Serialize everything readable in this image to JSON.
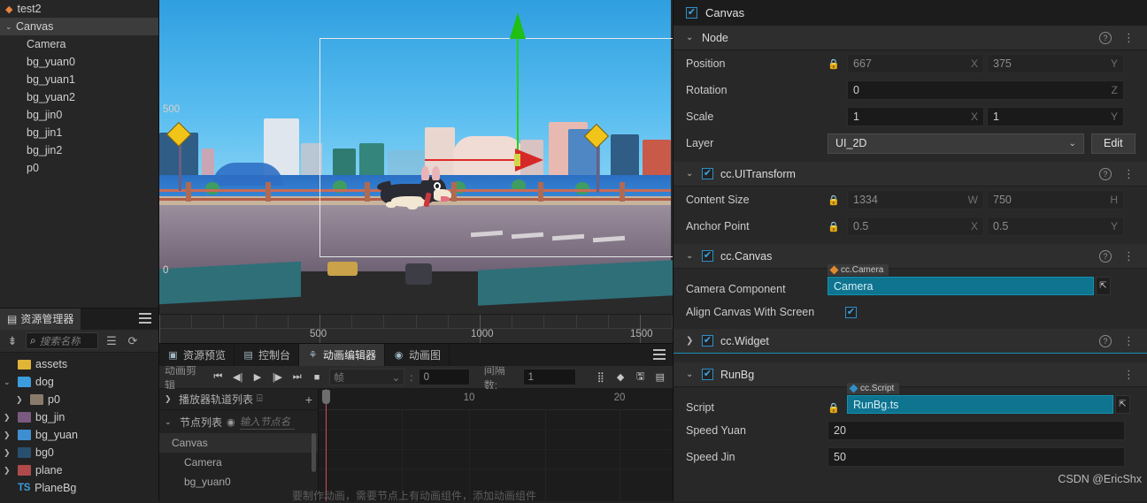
{
  "hierarchy": {
    "project": "test2",
    "nodes": [
      {
        "label": "Canvas",
        "level": 0,
        "expandable": true,
        "selected": true
      },
      {
        "label": "Camera",
        "level": 1,
        "expandable": false,
        "selected": false
      },
      {
        "label": "bg_yuan0",
        "level": 1,
        "expandable": false,
        "selected": false
      },
      {
        "label": "bg_yuan1",
        "level": 1,
        "expandable": false,
        "selected": false
      },
      {
        "label": "bg_yuan2",
        "level": 1,
        "expandable": false,
        "selected": false
      },
      {
        "label": "bg_jin0",
        "level": 1,
        "expandable": false,
        "selected": false
      },
      {
        "label": "bg_jin1",
        "level": 1,
        "expandable": false,
        "selected": false
      },
      {
        "label": "bg_jin2",
        "level": 1,
        "expandable": false,
        "selected": false
      },
      {
        "label": "p0",
        "level": 1,
        "expandable": false,
        "selected": false
      }
    ]
  },
  "assets": {
    "tab_label": "资源管理器",
    "search_placeholder": "搜索名称",
    "items": [
      {
        "label": "assets",
        "level": 0,
        "expandable": false,
        "icon": "database-icon",
        "color": "#e0b437"
      },
      {
        "label": "dog",
        "level": 0,
        "expandable": true,
        "expanded": true,
        "icon": "folder-icon",
        "color": "#3b9ddd"
      },
      {
        "label": "p0",
        "level": 1,
        "expandable": true,
        "expanded": false,
        "icon": "sprite-icon",
        "color": "#8a7a6a"
      },
      {
        "label": "bg_jin",
        "level": 0,
        "expandable": true,
        "expanded": false,
        "icon": "image-icon",
        "color": "#7a5a7e"
      },
      {
        "label": "bg_yuan",
        "level": 0,
        "expandable": true,
        "expanded": false,
        "icon": "image-icon",
        "color": "#3f8fd0"
      },
      {
        "label": "bg0",
        "level": 0,
        "expandable": true,
        "expanded": false,
        "icon": "image-icon",
        "color": "#28506e"
      },
      {
        "label": "plane",
        "level": 0,
        "expandable": true,
        "expanded": false,
        "icon": "image-icon",
        "color": "#b04a4a"
      },
      {
        "label": "PlaneBg",
        "level": 0,
        "expandable": false,
        "icon": "typescript-icon",
        "color": "#3b9ddd"
      }
    ]
  },
  "scene": {
    "ruler_x_labels": [
      "500",
      "1000",
      "1500"
    ],
    "ruler_y_labels": [
      "500",
      "0"
    ]
  },
  "animation": {
    "tabs": [
      {
        "label": "资源预览",
        "icon": "preview-icon",
        "active": false
      },
      {
        "label": "控制台",
        "icon": "console-icon",
        "active": false
      },
      {
        "label": "动画编辑器",
        "icon": "animation-icon",
        "active": true
      },
      {
        "label": "动画图",
        "icon": "graph-icon",
        "active": false
      }
    ],
    "toolbar": {
      "clip_label": "动画剪辑",
      "frame_mode": "帧",
      "colon": ":",
      "frame_value": "0",
      "interval_label": "间隔数:",
      "interval_value": "1"
    },
    "track_header": "播放器轨道列表",
    "node_header": "节点列表",
    "node_input_placeholder": "输入节点名",
    "node_rows": [
      {
        "label": "Canvas",
        "level": 1,
        "selected": true
      },
      {
        "label": "Camera",
        "level": 2,
        "selected": false
      },
      {
        "label": "bg_yuan0",
        "level": 2,
        "selected": false
      }
    ],
    "ruler_labels": [
      "10",
      "20"
    ],
    "bottom_hint": "要制作动画，需要节点上有动画组件，添加动画组件"
  },
  "inspector": {
    "node_name": "Canvas",
    "node_enabled": true,
    "sections": {
      "node": {
        "title": "Node",
        "rows": [
          {
            "label": "Position",
            "locked": true,
            "x": "667",
            "y": "375",
            "xa": "X",
            "ya": "Y"
          },
          {
            "label": "Rotation",
            "locked": false,
            "x": "0",
            "xa": "Z"
          },
          {
            "label": "Scale",
            "locked": false,
            "x": "1",
            "y": "1",
            "xa": "X",
            "ya": "Y"
          }
        ],
        "layer_label": "Layer",
        "layer_value": "UI_2D",
        "edit_label": "Edit"
      },
      "ui_transform": {
        "title": "cc.UITransform",
        "enabled": true,
        "rows": [
          {
            "label": "Content Size",
            "locked": true,
            "x": "1334",
            "y": "750",
            "xa": "W",
            "ya": "H"
          },
          {
            "label": "Anchor Point",
            "locked": true,
            "x": "0.5",
            "y": "0.5",
            "xa": "X",
            "ya": "Y"
          }
        ]
      },
      "canvas": {
        "title": "cc.Canvas",
        "enabled": true,
        "camera_label": "Camera Component",
        "camera_badge": "cc.Camera",
        "camera_value": "Camera",
        "align_label": "Align Canvas With Screen",
        "align_checked": true
      },
      "widget": {
        "title": "cc.Widget",
        "enabled": true,
        "collapsed": true
      },
      "runbg": {
        "title": "RunBg",
        "enabled": true,
        "script_label": "Script",
        "script_badge": "cc.Script",
        "script_value": "RunBg.ts",
        "props": [
          {
            "label": "Speed Yuan",
            "value": "20"
          },
          {
            "label": "Speed Jin",
            "value": "50"
          }
        ]
      }
    },
    "watermark": "CSDN @EricShx"
  },
  "colors": {
    "accent": "#0e7490",
    "checkbox": "#3ea4e0",
    "gizmo_y": "#23d118",
    "gizmo_x": "#d62828",
    "typescript": "#3b9ddd"
  }
}
